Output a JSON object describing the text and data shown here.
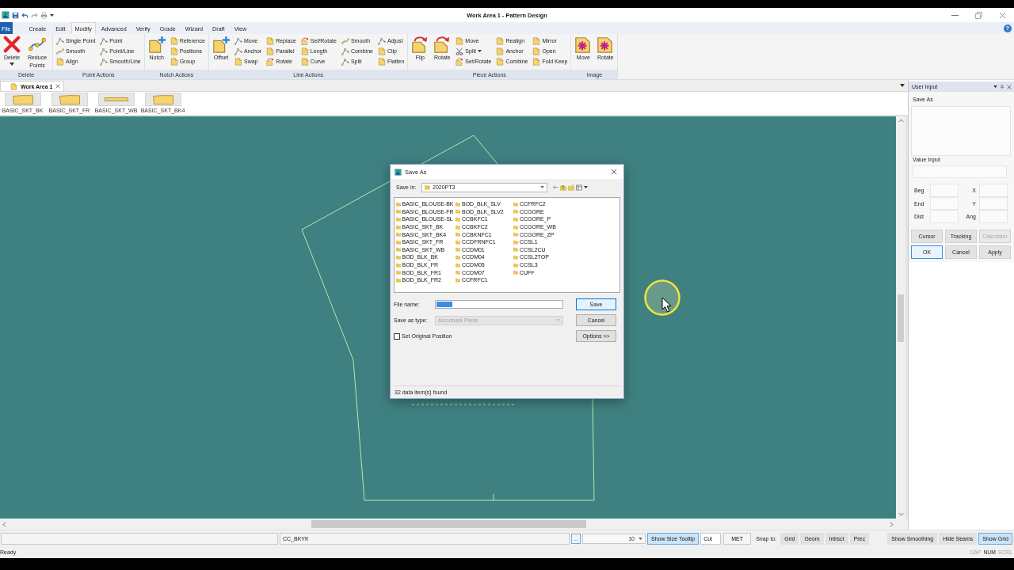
{
  "window": {
    "title": "Work Area 1 - Pattern Design"
  },
  "menu_tabs": [
    {
      "label": "File",
      "kind": "file",
      "selected": false
    },
    {
      "label": "Create",
      "kind": "tab",
      "selected": false
    },
    {
      "label": "Edit",
      "kind": "tab",
      "selected": false
    },
    {
      "label": "Modify",
      "kind": "tab",
      "selected": true
    },
    {
      "label": "Advanced",
      "kind": "tab",
      "selected": false
    },
    {
      "label": "Verify",
      "kind": "tab",
      "selected": false
    },
    {
      "label": "Grade",
      "kind": "tab",
      "selected": false
    },
    {
      "label": "Wizard",
      "kind": "tab",
      "selected": false
    },
    {
      "label": "Draft",
      "kind": "tab",
      "selected": false
    },
    {
      "label": "View",
      "kind": "tab",
      "selected": false
    }
  ],
  "help_button": "?",
  "ribbon_groups": [
    {
      "label": "Delete",
      "items": [
        {
          "kind": "large",
          "label": "Delete",
          "has_menu": true
        },
        {
          "kind": "large",
          "label": "Reduce Points",
          "has_menu": false
        }
      ]
    },
    {
      "label": "Point Actions",
      "items": [
        {
          "kind": "small",
          "label": "Single Point",
          "has_menu": false
        },
        {
          "kind": "small",
          "label": "Smooth",
          "has_menu": false
        },
        {
          "kind": "small",
          "label": "Align",
          "has_menu": false
        },
        {
          "kind": "small",
          "label": "Point",
          "has_menu": false
        },
        {
          "kind": "small",
          "label": "Point/Line",
          "has_menu": false
        },
        {
          "kind": "small",
          "label": "Smooth/Line",
          "has_menu": false
        }
      ]
    },
    {
      "label": "Notch Actions",
      "items": [
        {
          "kind": "large",
          "label": "Notch",
          "has_menu": false
        },
        {
          "kind": "small",
          "label": "Reference",
          "has_menu": false
        },
        {
          "kind": "small",
          "label": "Positions",
          "has_menu": false
        },
        {
          "kind": "small",
          "label": "Group",
          "has_menu": false
        }
      ]
    },
    {
      "label": "Line Actions",
      "items": [
        {
          "kind": "large",
          "label": "Offset",
          "has_menu": false
        },
        {
          "kind": "small",
          "label": "Move",
          "has_menu": false
        },
        {
          "kind": "small",
          "label": "Anchor",
          "has_menu": false
        },
        {
          "kind": "small",
          "label": "Swap",
          "has_menu": false
        },
        {
          "kind": "small",
          "label": "Replace",
          "has_menu": false
        },
        {
          "kind": "small",
          "label": "Parallel",
          "has_menu": false
        },
        {
          "kind": "small",
          "label": "Rotate",
          "has_menu": false
        },
        {
          "kind": "small",
          "label": "Set/Rotate",
          "has_menu": false
        },
        {
          "kind": "small",
          "label": "Length",
          "has_menu": false
        },
        {
          "kind": "small",
          "label": "Curve",
          "has_menu": false
        },
        {
          "kind": "small",
          "label": "Smooth",
          "has_menu": false
        },
        {
          "kind": "small",
          "label": "Combine",
          "has_menu": false
        },
        {
          "kind": "small",
          "label": "Split",
          "has_menu": false
        },
        {
          "kind": "small",
          "label": "Adjust",
          "has_menu": false
        },
        {
          "kind": "small",
          "label": "Clip",
          "has_menu": false
        },
        {
          "kind": "small",
          "label": "Flatten",
          "has_menu": false
        }
      ]
    },
    {
      "label": "Piece Actions",
      "items": [
        {
          "kind": "large",
          "label": "Flip",
          "has_menu": false
        },
        {
          "kind": "large",
          "label": "Rotate",
          "has_menu": false
        },
        {
          "kind": "small",
          "label": "Move",
          "has_menu": false
        },
        {
          "kind": "small",
          "label": "Split",
          "has_menu": true
        },
        {
          "kind": "small",
          "label": "Set/Rotate",
          "has_menu": false
        },
        {
          "kind": "small",
          "label": "Realign",
          "has_menu": false
        },
        {
          "kind": "small",
          "label": "Anchor",
          "has_menu": false
        },
        {
          "kind": "small",
          "label": "Combine",
          "has_menu": false
        },
        {
          "kind": "small",
          "label": "Mirror",
          "has_menu": false
        },
        {
          "kind": "small",
          "label": "Open",
          "has_menu": false
        },
        {
          "kind": "small",
          "label": "Fold Keep",
          "has_menu": false
        }
      ]
    },
    {
      "label": "Image",
      "items": [
        {
          "kind": "large",
          "label": "Move",
          "has_menu": false
        },
        {
          "kind": "large",
          "label": "Rotate",
          "has_menu": false
        }
      ]
    }
  ],
  "document_tabs": [
    {
      "label": "Work Area 1",
      "selected": true
    }
  ],
  "piece_thumbnails": [
    {
      "label": "BASIC_SKT_BK",
      "kind": "panel"
    },
    {
      "label": "BASIC_SKT_FR",
      "kind": "panel"
    },
    {
      "label": "BASIC_SKT_WB",
      "kind": "band"
    },
    {
      "label": "BASIC_SKT_BK4",
      "kind": "panel"
    }
  ],
  "save_as_dialog": {
    "title": "Save As",
    "save_in": {
      "label": "Save in:",
      "value": "2020PT3"
    },
    "folders": [
      "BASIC_BLOUSE-BK",
      "BASIC_BLOUSE-FR",
      "BASIC_BLOUSE-SL",
      "BASIC_SKT_BK",
      "BASIC_SKT_BK4",
      "BASIC_SKT_FR",
      "BASIC_SKT_WB",
      "BOD_BLK_BK",
      "BOD_BLK_FR",
      "BOD_BLK_FR1",
      "BOD_BLK_FR2",
      "BOD_BLK_SLV",
      "BOD_BLK_SLV2",
      "CCBKFC1",
      "CCBKFC2",
      "CCBKNFC1",
      "CCDFRNFC1",
      "CCDM01",
      "CCDM04",
      "CCDM05",
      "CCDM07",
      "CCFRFC1",
      "CCFRFC2",
      "CCGORE",
      "CCGORE_P",
      "CCGORE_WB",
      "CCGORE_ZP",
      "CCSL1",
      "CCSL2CU",
      "CCSL2TOP",
      "CCSL3",
      "CUFF"
    ],
    "file_name": {
      "label": "File name:",
      "text_selected": true
    },
    "save_as_type": {
      "label": "Save as type:",
      "value": "Accumark Piece",
      "disabled": true
    },
    "buttons": [
      {
        "label": "Save",
        "default": true
      },
      {
        "label": "Cancel",
        "default": false
      },
      {
        "label": "Options >>",
        "default": false
      }
    ],
    "set_original_position": {
      "label": "Set Original Position",
      "checked": false
    },
    "status": "32 data item(s) found"
  },
  "user_input_panel": {
    "title": "User Input",
    "section_label": "Save As",
    "value_input_label": "Value Input",
    "coordinate_rows": [
      {
        "left": "Beg",
        "right": "X"
      },
      {
        "left": "End",
        "right": "Y"
      },
      {
        "left": "Dist",
        "right": "Ang"
      }
    ],
    "mode_buttons": [
      {
        "label": "Cursor",
        "disabled": false
      },
      {
        "label": "Tracking",
        "disabled": false
      },
      {
        "label": "Calculator",
        "disabled": true
      }
    ],
    "action_buttons": [
      {
        "label": "OK",
        "focused": true
      },
      {
        "label": "Cancel",
        "focused": false
      },
      {
        "label": "Apply",
        "focused": false
      }
    ]
  },
  "status_bar": {
    "piece_name": "CC_BKYK",
    "browse_button": "...",
    "size_value": "10",
    "tooltip_toggle": {
      "label": "Show Size Tooltip",
      "on": true
    },
    "cut_field": "Cut",
    "units_button": "MET",
    "snap_label": "Snap to:",
    "snap_options": [
      {
        "label": "Grid",
        "on": false
      },
      {
        "label": "Geom",
        "on": false
      },
      {
        "label": "Intrsct",
        "on": false
      },
      {
        "label": "Prec",
        "on": false
      }
    ],
    "view_toggles": [
      {
        "label": "Show Smoothing",
        "on": false
      },
      {
        "label": "Hide Seams",
        "on": false
      },
      {
        "label": "Show Grid",
        "on": true
      }
    ],
    "message": "Ready",
    "indicators": [
      {
        "label": "CAP",
        "on": false
      },
      {
        "label": "NUM",
        "on": true
      },
      {
        "label": "SCRL",
        "on": false
      }
    ]
  }
}
